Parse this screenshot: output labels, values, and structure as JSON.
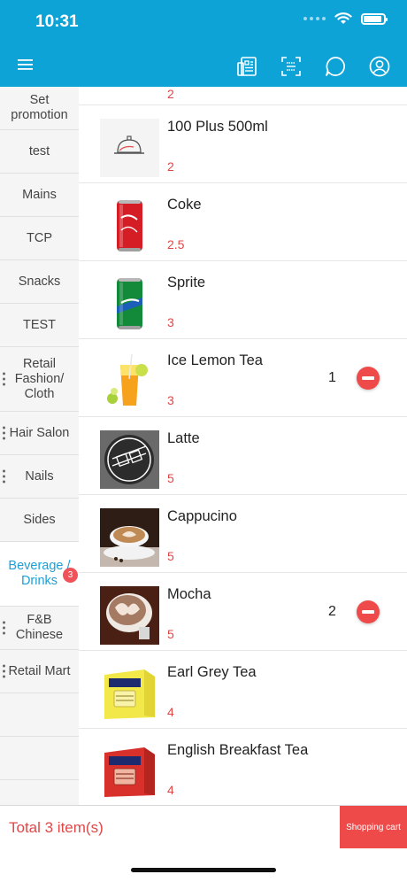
{
  "status_bar": {
    "time": "10:31"
  },
  "header": {
    "menu_icon": "hamburger-menu-icon",
    "actions": [
      {
        "name": "receipt-icon"
      },
      {
        "name": "barcode-scan-icon"
      },
      {
        "name": "chat-icon"
      },
      {
        "name": "user-profile-icon"
      }
    ]
  },
  "sidebar": {
    "categories": [
      {
        "label": "Set promotion"
      },
      {
        "label": "test"
      },
      {
        "label": "Mains"
      },
      {
        "label": "TCP"
      },
      {
        "label": "Snacks"
      },
      {
        "label": "TEST"
      },
      {
        "label": "Retail Fashion/ Cloth"
      },
      {
        "label": "Hair Salon"
      },
      {
        "label": "Nails"
      },
      {
        "label": "Sides"
      },
      {
        "label": "Beverage / Drinks",
        "badge": "3"
      },
      {
        "label": "F&B Chinese"
      },
      {
        "label": "Retail Mart"
      }
    ]
  },
  "products": {
    "partial_price": "2",
    "items": [
      {
        "name": "100 Plus 500ml",
        "price": "2",
        "qty": ""
      },
      {
        "name": "Coke",
        "price": "2.5",
        "qty": ""
      },
      {
        "name": "Sprite",
        "price": "3",
        "qty": ""
      },
      {
        "name": "Ice Lemon Tea",
        "price": "3",
        "qty": "1"
      },
      {
        "name": "Latte",
        "price": "5",
        "qty": ""
      },
      {
        "name": "Cappucino",
        "price": "5",
        "qty": ""
      },
      {
        "name": "Mocha",
        "price": "5",
        "qty": "2"
      },
      {
        "name": "Earl Grey Tea",
        "price": "4",
        "qty": ""
      },
      {
        "name": "English Breakfast Tea",
        "price": "4",
        "qty": ""
      }
    ]
  },
  "footer": {
    "total_label": "Total 3 item(s)",
    "cart_button": "Shopping cart"
  },
  "colors": {
    "accent": "#0ea3d6",
    "price": "#e04848",
    "danger": "#ef4a4a"
  }
}
